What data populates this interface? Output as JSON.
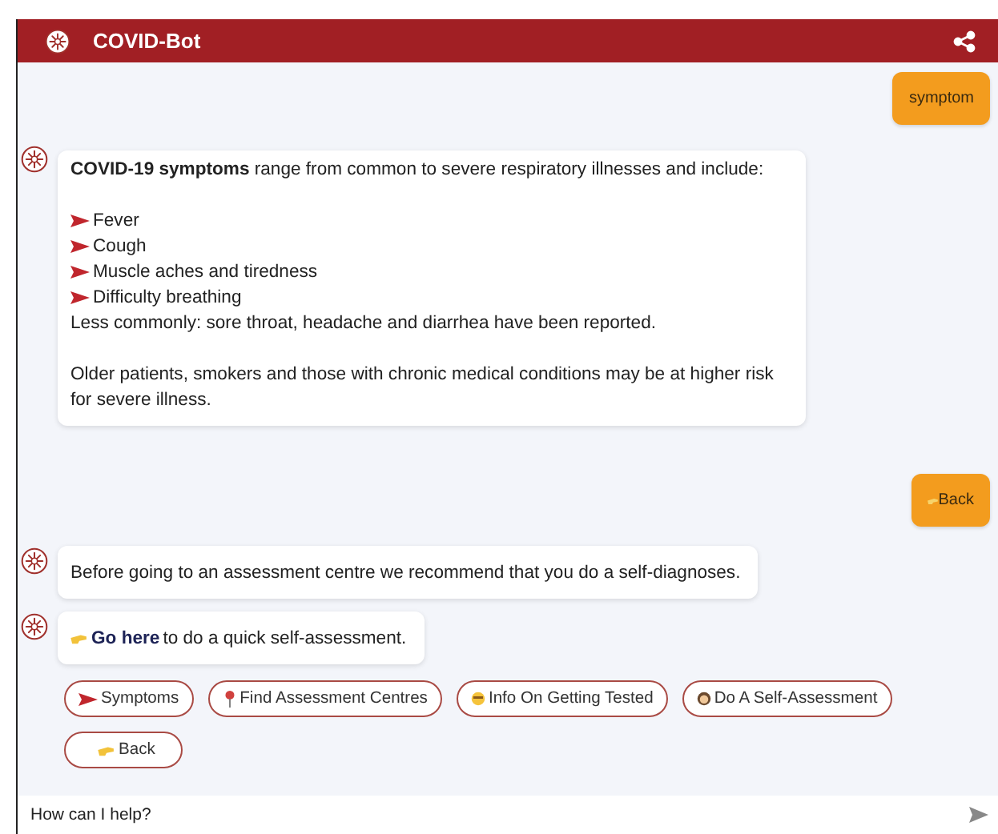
{
  "header": {
    "title": "COVID-Bot"
  },
  "messages": [
    {
      "kind": "user",
      "text": "symptom",
      "icon": false
    },
    {
      "kind": "bot",
      "paragraphs": [
        [
          {
            "kind": "text",
            "text": "**COVID-19 symptoms** range from common to severe respiratory illnesses and include:"
          }
        ],
        [
          {
            "kind": "bullet",
            "text": "Fever"
          },
          {
            "kind": "bullet",
            "text": "Cough"
          },
          {
            "kind": "bullet",
            "text": "Muscle aches and tiredness"
          },
          {
            "kind": "bullet",
            "text": "Difficulty breathing"
          },
          {
            "kind": "text",
            "text": "Less commonly: sore throat, headache and diarrhea have been reported."
          }
        ],
        [
          {
            "kind": "text",
            "text": "Older patients, smokers and those with chronic medical conditions may be at higher risk for severe illness."
          }
        ]
      ]
    },
    {
      "kind": "user",
      "text": "Back",
      "icon": true
    },
    {
      "kind": "bot",
      "paragraphs": [
        [
          {
            "kind": "text",
            "text": "Before going to an assessment centre we recommend that you do a self-diagnoses."
          }
        ]
      ]
    },
    {
      "kind": "bot",
      "paragraphs": [
        [
          {
            "kind": "link",
            "link": "Go here",
            "text": " to do a quick self-assessment."
          }
        ]
      ]
    }
  ],
  "quick_replies": [
    {
      "label": "Symptoms"
    },
    {
      "label": "Find Assessment Centres"
    },
    {
      "label": "Info On Getting Tested"
    },
    {
      "label": "Do A Self-Assessment"
    },
    {
      "label": "Back"
    }
  ],
  "input": {
    "placeholder": "How can I help?"
  }
}
